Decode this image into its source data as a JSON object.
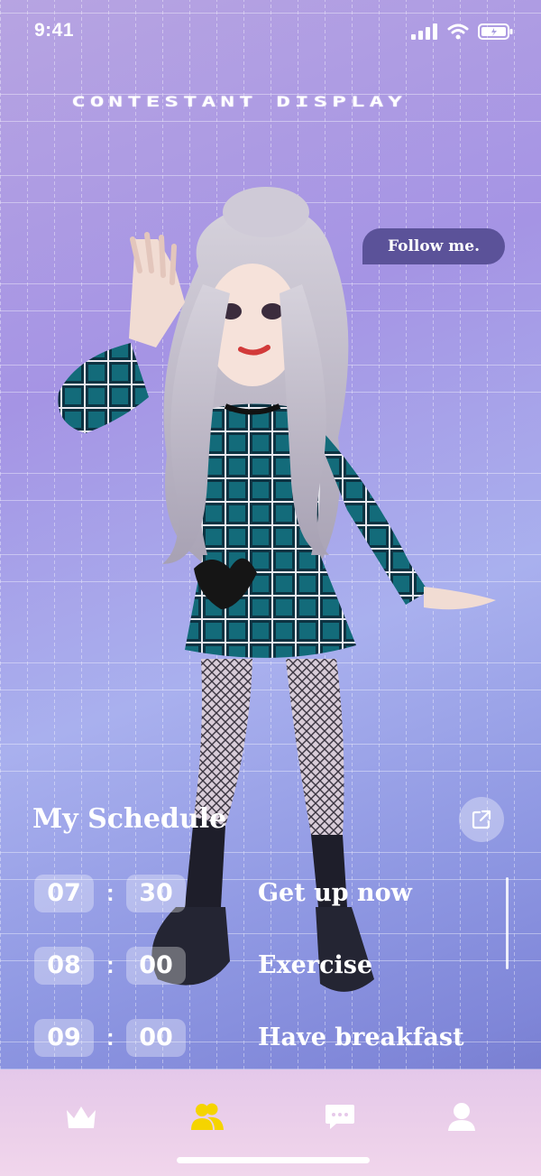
{
  "status_bar": {
    "time": "9:41"
  },
  "header": {
    "title": "CONTESTANT DISPLAY"
  },
  "bubble": {
    "text": "Follow me."
  },
  "schedule": {
    "title": "My Schedule",
    "items": [
      {
        "hour": "07",
        "minute": "30",
        "task": "Get up now"
      },
      {
        "hour": "08",
        "minute": "00",
        "task": "Exercise"
      },
      {
        "hour": "09",
        "minute": "00",
        "task": "Have breakfast"
      }
    ]
  },
  "tab_bar": {
    "tabs": [
      {
        "icon": "crown-icon",
        "active": false
      },
      {
        "icon": "people-icon",
        "active": true
      },
      {
        "icon": "chat-icon",
        "active": false
      },
      {
        "icon": "profile-icon",
        "active": false
      }
    ]
  },
  "colors": {
    "active_tab": "#f5d400",
    "inactive_tab": "#ffffff",
    "bubble": "#5b5299",
    "tab_bar_background": "#ecd0ea"
  }
}
